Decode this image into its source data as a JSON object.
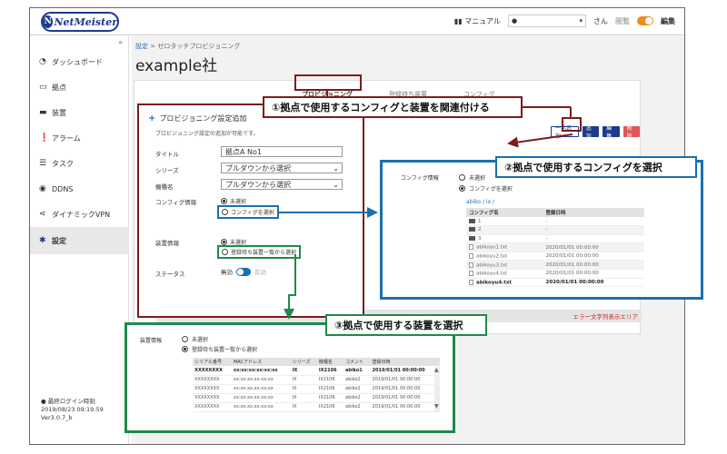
{
  "topbar": {
    "logo_text": "NetMeister",
    "manual_label": "マニュアル",
    "user_suffix": "さん",
    "view_label": "閲覧",
    "edit_label": "編集"
  },
  "sidebar": {
    "collapse": "«",
    "items": [
      {
        "label": "ダッシュボード",
        "icon": "dashboard-icon"
      },
      {
        "label": "拠点",
        "icon": "site-icon"
      },
      {
        "label": "装置",
        "icon": "device-icon"
      },
      {
        "label": "アラーム",
        "icon": "alarm-icon"
      },
      {
        "label": "タスク",
        "icon": "task-icon"
      },
      {
        "label": "DDNS",
        "icon": "globe-icon"
      },
      {
        "label": "ダイナミックVPN",
        "icon": "share-icon"
      },
      {
        "label": "設定",
        "icon": "gear-icon"
      }
    ],
    "footer": {
      "last_login_label": "最終ログイン時刻",
      "last_login_time": "2019/08/23 09:19:59",
      "version": "Ver3.0.7_b"
    }
  },
  "main": {
    "breadcrumb_link": "設定",
    "breadcrumb_rest": " > ゼロタッチプロビジョニング",
    "title": "example社",
    "tabs": [
      "プロビジョニング",
      "登録待ち装置",
      "コンフィグ"
    ],
    "action_buttons": [
      "一括追加",
      "追加",
      "編集",
      "削除"
    ],
    "error_area": "エラー文字列表示エリア"
  },
  "form": {
    "title": "プロビジョニング設定追加",
    "description": "プロビジョニング設定の追加が可能です。",
    "title_label": "タイトル",
    "title_value": "拠点A No1",
    "series_label": "シリーズ",
    "series_value": "プルダウンから選択",
    "model_label": "機種名",
    "model_value": "プルダウンから選択",
    "config_label": "コンフィグ情報",
    "config_opt_none": "未選択",
    "config_opt_select": "コンフィグを選択",
    "device_label": "装置情報",
    "device_opt_none": "未選択",
    "device_opt_select": "登録待ち装置一覧から選択",
    "status_label": "ステータス",
    "status_on": "無効",
    "status_off": "有効"
  },
  "callouts": {
    "c1": "①拠点で使用するコンフィグと装置を関連付ける",
    "c2": "②拠点で使用するコンフィグを選択",
    "c3": "③拠点で使用する装置を選択"
  },
  "config_panel": {
    "label": "コンフィグ情報",
    "opt_none": "未選択",
    "opt_select": "コンフィグを選択",
    "path": "abiko / ix /",
    "columns": [
      "コンフィグ名",
      "登録日時"
    ],
    "rows": [
      {
        "name": "1",
        "date": "-",
        "type": "folder"
      },
      {
        "name": "2",
        "date": "-",
        "type": "folder"
      },
      {
        "name": "3",
        "date": "-",
        "type": "folder"
      },
      {
        "name": "abikoyu1.txt",
        "date": "2020/01/01 00:00:00",
        "type": "file"
      },
      {
        "name": "abikoyu2.txt",
        "date": "2020/01/01 00:00:00",
        "type": "file"
      },
      {
        "name": "abikoyu3.txt",
        "date": "2020/01/01 00:00:00",
        "type": "file"
      },
      {
        "name": "abikoyu4.txt",
        "date": "2020/01/01 00:00:00",
        "type": "file"
      },
      {
        "name": "abikoyu4.txt",
        "date": "2020/01/01 00:00:00",
        "type": "file",
        "bold": true
      }
    ]
  },
  "device_panel": {
    "label": "装置情報",
    "opt_none": "未選択",
    "opt_select": "登録待ち装置一覧から選択",
    "columns": [
      "シリアル番号",
      "MACアドレス",
      "シリーズ",
      "機種名",
      "コメント",
      "登録日時"
    ],
    "rows": [
      [
        "XXXXXXXX",
        "xx:xx:xx:xx:xx:xx",
        "IX",
        "IX2106",
        "abiko1",
        "2019/01/01 00:00:00",
        true
      ],
      [
        "XXXXXXXX",
        "xx:xx:xx:xx:xx:xx",
        "IX",
        "IX2106",
        "abiko2",
        "2019/01/01 00:00:00",
        false
      ],
      [
        "XXXXXXXX",
        "xx:xx:xx:xx:xx:xx",
        "IX",
        "IX2106",
        "abiko2",
        "2019/01/01 00:00:00",
        false
      ],
      [
        "XXXXXXXX",
        "xx:xx:xx:xx:xx:xx",
        "IX",
        "IX2106",
        "abiko2",
        "2019/01/01 00:00:00",
        false
      ],
      [
        "XXXXXXXX",
        "xx:xx:xx:xx:xx:xx",
        "IX",
        "IX2106",
        "abiko2",
        "2019/01/01 00:00:00",
        false
      ]
    ]
  },
  "colors": {
    "brand": "#1d3b8c",
    "callout1": "#7a1d1d",
    "callout2": "#1a6fb0",
    "callout3": "#1e8a4a",
    "edit_toggle": "#f08a1c"
  }
}
